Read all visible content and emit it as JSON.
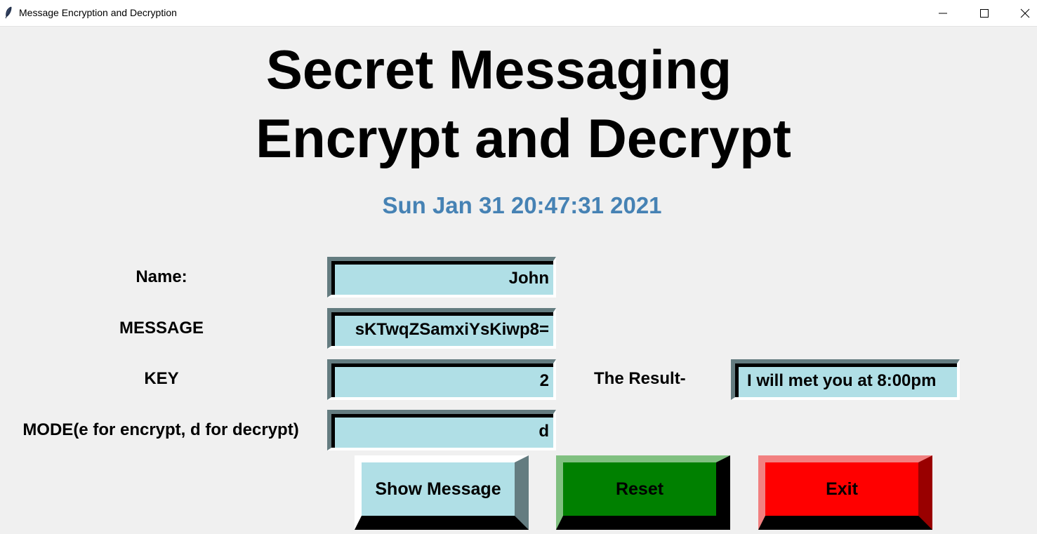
{
  "window": {
    "title": "Message Encryption and Decryption",
    "icon": "feather-icon"
  },
  "heading": {
    "line1": "Secret Messaging",
    "line2": "Encrypt and Decrypt"
  },
  "datetime": "Sun Jan 31 20:47:31 2021",
  "form": {
    "name_label": "Name:",
    "name_value": "John",
    "message_label": "MESSAGE",
    "message_value": "sKTwqZSamxiYsKiwp8=",
    "key_label": "KEY",
    "key_value": "2",
    "mode_label": "MODE(e for encrypt, d for decrypt)",
    "mode_value": "d",
    "result_label": "The Result-",
    "result_value": "I will met you at 8:00pm"
  },
  "buttons": {
    "show": "Show Message",
    "reset": "Reset",
    "exit": "Exit"
  },
  "colors": {
    "date": "#4682b4",
    "entry_bg": "#b0dfe6",
    "reset_bg": "#008000",
    "exit_bg": "#ff0000"
  }
}
